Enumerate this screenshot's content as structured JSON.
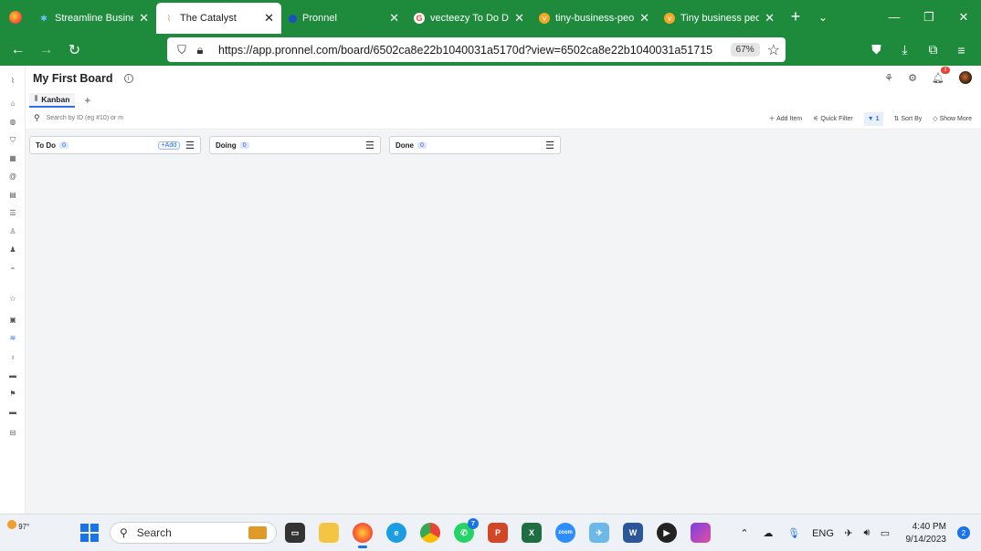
{
  "browser": {
    "tabs": [
      {
        "title": "Streamline Business",
        "icon": "streamline-favicon-icon",
        "active": false
      },
      {
        "title": "The Catalyst",
        "icon": "catalyst-favicon-icon",
        "active": true
      },
      {
        "title": "Pronnel",
        "icon": "pronnel-favicon-icon",
        "active": false
      },
      {
        "title": "vecteezy To Do Dor",
        "icon": "google-favicon-icon",
        "active": false
      },
      {
        "title": "tiny-business-peopl",
        "icon": "vecteezy-favicon-icon",
        "active": false
      },
      {
        "title": "Tiny business peopl",
        "icon": "vecteezy-favicon-icon",
        "active": false
      }
    ],
    "url": "https://app.pronnel.com/board/6502ca8e22b1040031a5170d?view=6502ca8e22b1040031a51715",
    "zoom": "67%",
    "accent": "#1e8a3c"
  },
  "app": {
    "board_title": "My First Board",
    "view_tab": "Kanban",
    "search_placeholder": "Search by ID (eg #10) or m",
    "toolbar": {
      "add_item": "Add Item",
      "quick_filter": "Quick Filter",
      "filter_count": "1",
      "sort_by": "Sort By",
      "show_more": "Show More"
    },
    "notification_count": "2",
    "columns": [
      {
        "name": "To Do",
        "count": "0",
        "add_label": "+Add"
      },
      {
        "name": "Doing",
        "count": "0"
      },
      {
        "name": "Done",
        "count": "0"
      }
    ]
  },
  "taskbar": {
    "weather": "97°",
    "search_label": "Search",
    "whatsapp_badge": "7",
    "language": "ENG",
    "time": "4:40 PM",
    "date": "9/14/2023",
    "notification_count": "2"
  }
}
